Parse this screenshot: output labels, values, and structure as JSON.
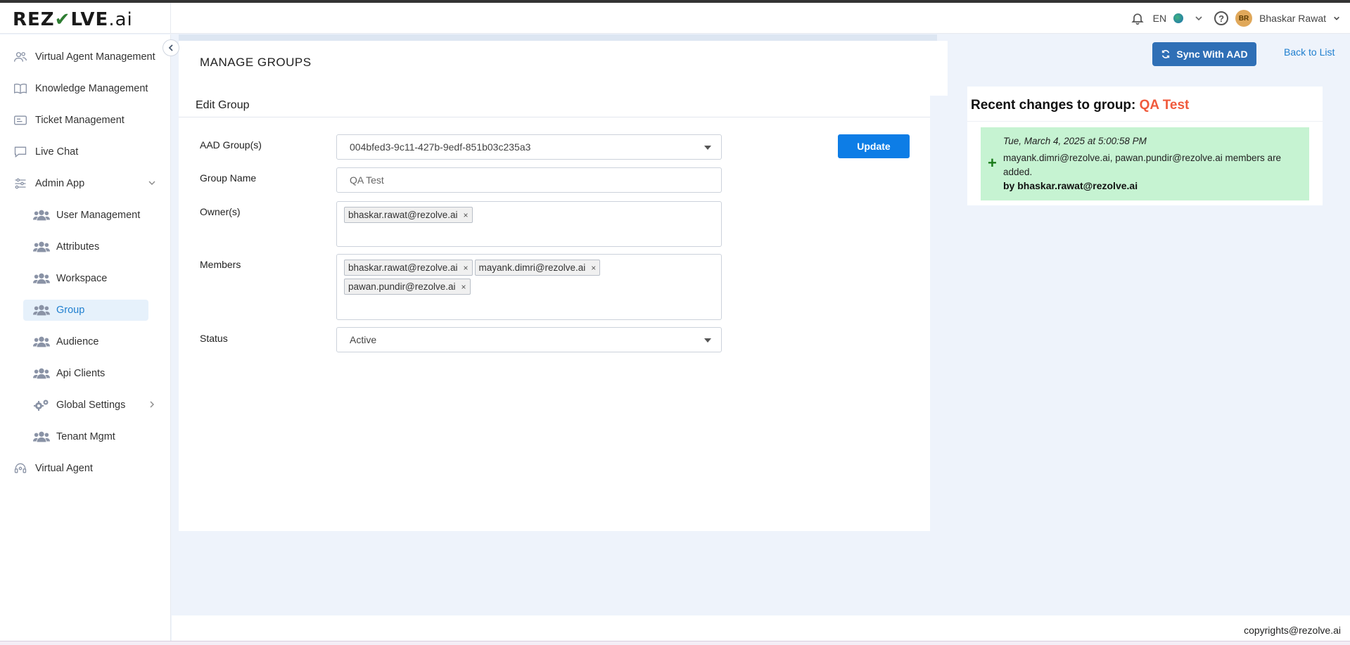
{
  "header": {
    "logo_main": "REZ",
    "logo_check": "✔",
    "logo_rest": "LVE",
    "logo_suffix": ".ai",
    "language": "EN",
    "avatar_initials": "BR",
    "user_name": "Bhaskar Rawat"
  },
  "sidebar": {
    "items": [
      {
        "label": "Virtual Agent Management",
        "icon": "users-icon"
      },
      {
        "label": "Knowledge Management",
        "icon": "book-icon"
      },
      {
        "label": "Ticket Management",
        "icon": "ticket-icon"
      },
      {
        "label": "Live Chat",
        "icon": "chat-icon"
      },
      {
        "label": "Admin App",
        "icon": "sliders-icon"
      },
      {
        "label": "User Management",
        "icon": "group-icon"
      },
      {
        "label": "Attributes",
        "icon": "group-icon"
      },
      {
        "label": "Workspace",
        "icon": "group-icon"
      },
      {
        "label": "Group",
        "icon": "group-icon"
      },
      {
        "label": "Audience",
        "icon": "group-icon"
      },
      {
        "label": "Api Clients",
        "icon": "group-icon"
      },
      {
        "label": "Global Settings",
        "icon": "gears-icon"
      },
      {
        "label": "Tenant Mgmt",
        "icon": "group-icon"
      },
      {
        "label": "Virtual Agent",
        "icon": "headset-icon"
      }
    ],
    "active": "Group"
  },
  "page": {
    "title": "MANAGE GROUPS",
    "sync_label": "Sync With AAD",
    "back_label": "Back to List"
  },
  "form": {
    "card_title": "Edit Group",
    "aad_label": "AAD Group(s)",
    "aad_value": "004bfed3-9c11-427b-9edf-851b03c235a3",
    "name_label": "Group Name",
    "name_placeholder": "QA Test",
    "owners_label": "Owner(s)",
    "owners": [
      "bhaskar.rawat@rezolve.ai"
    ],
    "members_label": "Members",
    "members": [
      "bhaskar.rawat@rezolve.ai",
      "mayank.dimri@rezolve.ai",
      "pawan.pundir@rezolve.ai"
    ],
    "status_label": "Status",
    "status_value": "Active",
    "update_label": "Update",
    "tag_remove": "×"
  },
  "changes": {
    "title_prefix": "Recent changes to group:",
    "group_name": "QA Test",
    "entries": [
      {
        "symbol": "+",
        "date": "Tue, March 4, 2025 at 5:00:58 PM",
        "message": "mayank.dimri@rezolve.ai, pawan.pundir@rezolve.ai members are added.",
        "by": "by bhaskar.rawat@rezolve.ai"
      }
    ]
  },
  "footer": {
    "copyright": "copyrights@rezolve.ai"
  },
  "colors": {
    "accent": "#2f6fb6",
    "update": "#0d7de6",
    "group_name": "#f05a3c",
    "entry_bg": "#c6f3d2",
    "active_nav": "#1f7fcf"
  }
}
